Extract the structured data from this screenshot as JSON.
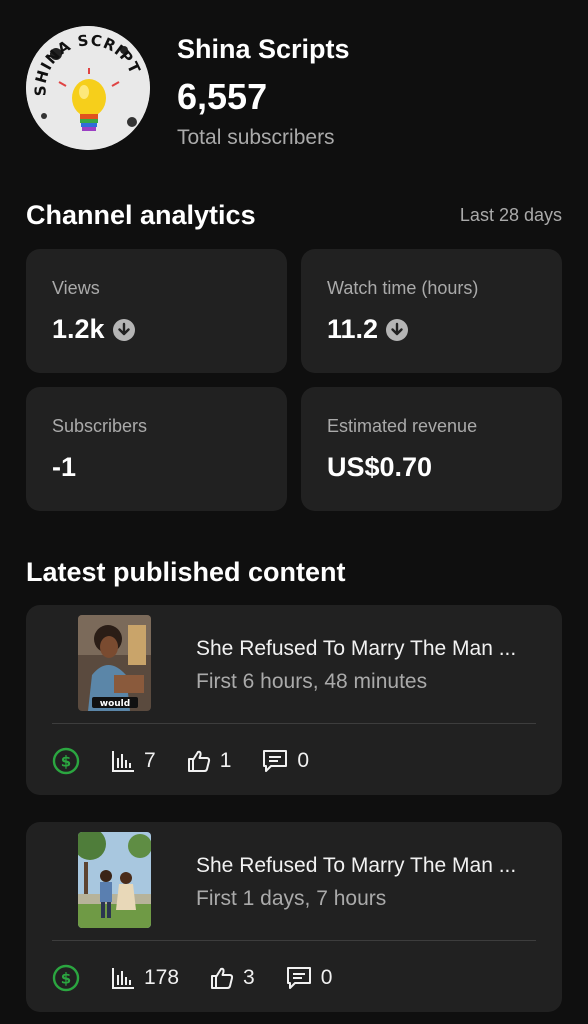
{
  "channel": {
    "name": "Shina Scripts",
    "subscriber_count": "6,557",
    "subscriber_label": "Total subscribers",
    "avatar_text": "SHINA SCRIPTS"
  },
  "analytics": {
    "title": "Channel analytics",
    "period": "Last 28 days",
    "metrics": [
      {
        "label": "Views",
        "value": "1.2k",
        "trend": "down"
      },
      {
        "label": "Watch time (hours)",
        "value": "11.2",
        "trend": "down"
      },
      {
        "label": "Subscribers",
        "value": "-1",
        "trend": "none"
      },
      {
        "label": "Estimated revenue",
        "value": "US$0.70",
        "trend": "none"
      }
    ]
  },
  "latest": {
    "title": "Latest published content",
    "items": [
      {
        "title": "She Refused To Marry The Man ...",
        "age": "First 6 hours, 48 minutes",
        "thumb_caption": "would",
        "views": "7",
        "likes": "1",
        "comments": "0"
      },
      {
        "title": "She Refused To Marry The Man ...",
        "age": "First 1 days, 7 hours",
        "thumb_caption": "",
        "views": "178",
        "likes": "3",
        "comments": "0"
      }
    ]
  },
  "icons": {
    "monetization": "dollar-circle-icon",
    "views": "bar-chart-icon",
    "likes": "thumbs-up-icon",
    "comments": "comment-icon",
    "trend": "arrow-down-circle-icon"
  },
  "colors": {
    "background": "#0f0f0f",
    "card": "#212121",
    "secondary_text": "#aaaaaa",
    "monetization_green": "#2ba640"
  }
}
